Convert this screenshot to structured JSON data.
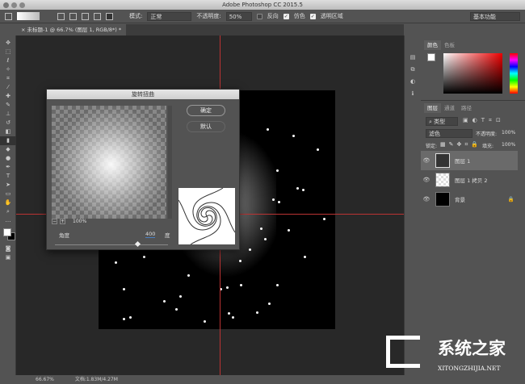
{
  "window": {
    "title": "Adobe Photoshop CC 2015.5"
  },
  "options": {
    "mode_label": "模式:",
    "mode_value": "正常",
    "opacity_label": "不透明度:",
    "opacity_value": "50%",
    "reverse_label": "反向",
    "dither_label": "仿色",
    "transparency_label": "透明区域",
    "workspace": "基本功能"
  },
  "document_tab": {
    "title": "未标题-1 @ 66.7% (图层 1, RGB/8*) *"
  },
  "dialog": {
    "title": "旋转扭曲",
    "ok": "确定",
    "default": "默认",
    "zoom": "100%",
    "angle_label": "角度",
    "angle_value": "400",
    "angle_unit": "度",
    "angle_fraction": 0.73
  },
  "color_panel": {
    "tabs": [
      "颜色",
      "色板"
    ]
  },
  "layers_panel": {
    "tabs": [
      "图层",
      "通道",
      "路径"
    ],
    "filter": "类型",
    "blend": "滤色",
    "opacity_label": "不透明度:",
    "opacity": "100%",
    "lock_label": "锁定:",
    "fill_label": "填充:",
    "fill": "100%",
    "layers": [
      {
        "name": "图层 1"
      },
      {
        "name": "图层 1 拷贝 2"
      },
      {
        "name": "背景"
      }
    ]
  },
  "status": {
    "zoom": "66.67%",
    "doc": "文档:1.83M/4.27M"
  },
  "watermark": {
    "text": "系统之家",
    "url": "XITONGZHIJIA.NET"
  }
}
